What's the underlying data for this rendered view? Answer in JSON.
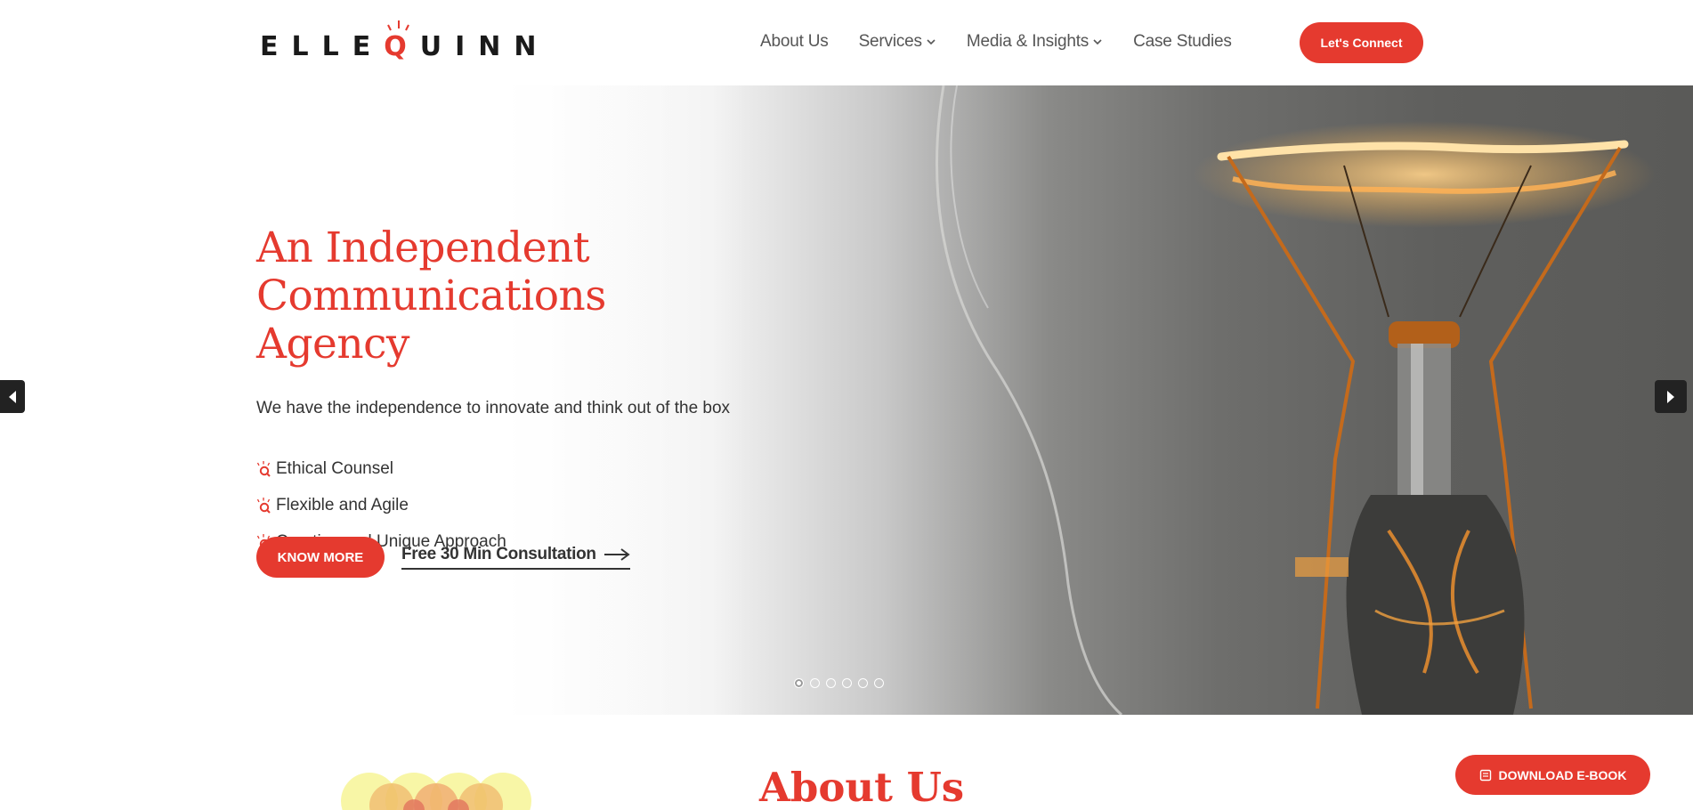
{
  "brand": {
    "logo_prefix": "ELLE",
    "logo_q": "Q",
    "logo_suffix": "UINN",
    "accent_color": "#e53a2f"
  },
  "nav": {
    "items": [
      {
        "label": "About Us",
        "has_dropdown": false
      },
      {
        "label": "Services",
        "has_dropdown": true
      },
      {
        "label": "Media & Insights",
        "has_dropdown": true
      },
      {
        "label": "Case Studies",
        "has_dropdown": false
      }
    ],
    "cta_label": "Let's Connect"
  },
  "hero": {
    "title_line1": "An Independent",
    "title_line2": "Communications Agency",
    "subtitle": "We have the independence to innovate and think out of the box",
    "bullets": [
      "Ethical Counsel",
      "Flexible and Agile",
      "Creative and Unique Approach"
    ],
    "bullet_icon": "q-logo-icon",
    "primary_button": "KNOW MORE",
    "secondary_link": "Free 30 Min Consultation",
    "slide_count": 6,
    "active_slide": 1
  },
  "about": {
    "title": "About Us"
  },
  "floating": {
    "ebook_label": "DOWNLOAD E-BOOK",
    "ebook_icon": "book-icon"
  }
}
